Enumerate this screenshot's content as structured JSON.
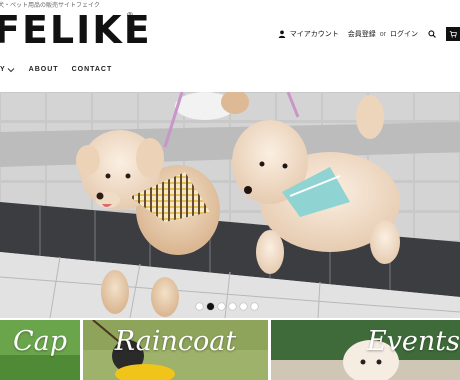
{
  "header": {
    "tagline": "犬・ペット用品の販売サイトフェイク",
    "logo": "FELIKE",
    "logo_mark": "®",
    "account": {
      "my_account": "マイアカウント",
      "register": "会員登録",
      "or": "or",
      "login": "ログイン"
    }
  },
  "nav": {
    "items": [
      {
        "label": "Y"
      },
      {
        "label": "ABOUT"
      },
      {
        "label": "CONTACT"
      }
    ]
  },
  "hero": {
    "slide_count": 6,
    "active_index": 1
  },
  "categories": [
    {
      "label": "Cap"
    },
    {
      "label": "Raincoat"
    },
    {
      "label": "Events"
    }
  ],
  "colors": {
    "accent": "#111111",
    "harness_plaid": "#e8c85a",
    "harness_mint": "#8fd3d2",
    "leash_pink": "#c996c9"
  }
}
